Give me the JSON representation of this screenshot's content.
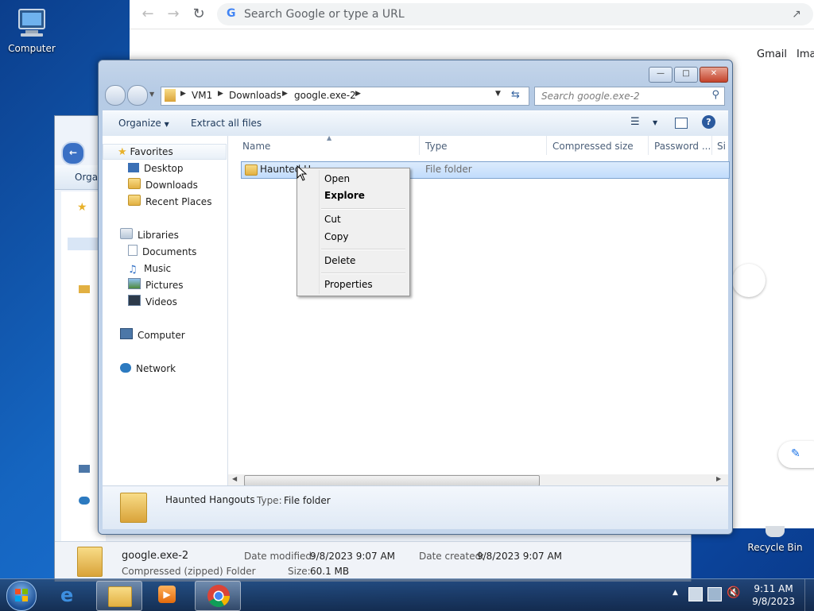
{
  "desktop": {
    "computer_label": "Computer",
    "recycle_label": "Recycle Bin"
  },
  "chrome": {
    "omnibox_placeholder": "Search Google or type a URL",
    "link_gmail": "Gmail",
    "link_images": "Ima"
  },
  "back_window": {
    "toolbar_organize": "Orga",
    "file_name": "google.exe-2",
    "file_type": "Compressed (zipped) Folder",
    "modified_label": "Date modified:",
    "modified_value": "9/8/2023 9:07 AM",
    "created_label": "Date created:",
    "created_value": "9/8/2023 9:07 AM",
    "size_label": "Size:",
    "size_value": "60.1 MB"
  },
  "explorer": {
    "breadcrumb": [
      "VM1",
      "Downloads",
      "google.exe-2"
    ],
    "search_placeholder": "Search google.exe-2",
    "toolbar": {
      "organize": "Organize",
      "extract": "Extract all files"
    },
    "nav": {
      "favorites": "Favorites",
      "desktop": "Desktop",
      "downloads": "Downloads",
      "recent": "Recent Places",
      "libraries": "Libraries",
      "documents": "Documents",
      "music": "Music",
      "pictures": "Pictures",
      "videos": "Videos",
      "computer": "Computer",
      "network": "Network"
    },
    "columns": {
      "name": "Name",
      "type": "Type",
      "compressed": "Compressed size",
      "password": "Password ...",
      "size": "Si"
    },
    "row": {
      "name": "Haunted H",
      "type": "File folder"
    },
    "details": {
      "name": "Haunted Hangouts",
      "type_label": "Type:",
      "type_value": "File folder"
    }
  },
  "context_menu": {
    "open": "Open",
    "explore": "Explore",
    "cut": "Cut",
    "copy": "Copy",
    "delete": "Delete",
    "properties": "Properties"
  },
  "taskbar": {
    "time": "9:11 AM",
    "date": "9/8/2023"
  }
}
